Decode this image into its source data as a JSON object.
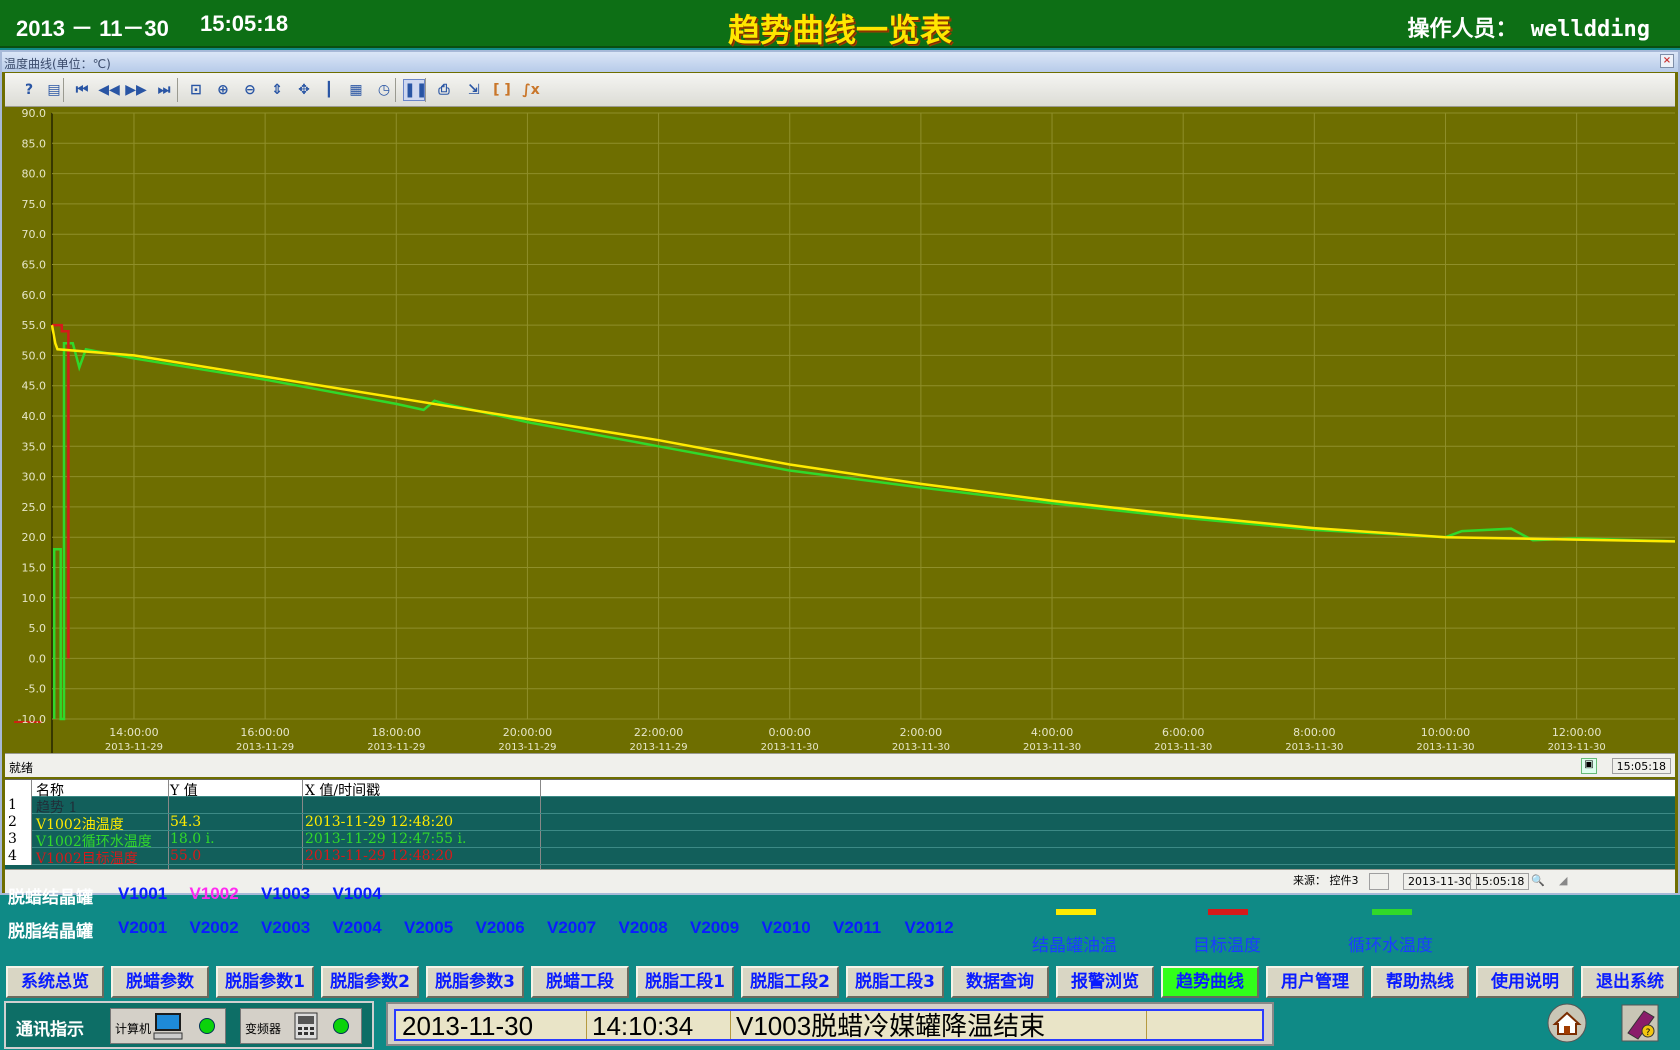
{
  "header": {
    "date": "2013 － 11－30",
    "time": "15:05:18",
    "title": "趋势曲线一览表",
    "operator": "操作人员： welldding"
  },
  "window": {
    "title": "温度曲线(单位：℃)",
    "close_label": "×",
    "status_text": "就绪",
    "status_time": "15:05:18",
    "toolbar_icons": [
      "help-icon",
      "properties-icon",
      "first-icon",
      "rewind-icon",
      "fast-forward-icon",
      "last-icon",
      "zoom-box-icon",
      "zoom-in-icon",
      "zoom-out-icon",
      "zoom-y-icon",
      "pan-icon",
      "ruler-icon",
      "grid-icon",
      "timer-icon",
      "pause-icon",
      "print-icon",
      "cursor-icon",
      "bracket-icon",
      "function-icon"
    ],
    "toolbar_glyphs": [
      "?",
      "▤",
      "⏮",
      "◀◀",
      "▶▶",
      "⏭",
      "⊡",
      "⊕",
      "⊖",
      "⇕",
      "✥",
      "┃",
      "▦",
      "◷",
      "❚❚",
      "⎙",
      "⇲",
      "[ ]",
      "∫x"
    ]
  },
  "legend_table": {
    "headers": [
      "名称",
      "Y 值",
      "X 值/时间戳"
    ],
    "rows": [
      {
        "num": "1",
        "name": "趋势 1",
        "y": "",
        "x": "",
        "color": "#20303a"
      },
      {
        "num": "2",
        "name": "V1002油温度",
        "y": "54.3",
        "x": "2013-11-29 12:48:20",
        "color": "#ffea00"
      },
      {
        "num": "3",
        "name": "V1002循环水温度",
        "y": "18.0 i.",
        "x": "2013-11-29 12:47:55 i.",
        "color": "#31d82a"
      },
      {
        "num": "4",
        "name": "V1002目标温度",
        "y": "55.0",
        "x": "2013-11-29 12:48:20",
        "color": "#d61a1a"
      }
    ]
  },
  "source_bar": {
    "source": "来源： 控件3",
    "date": "2013-11-30",
    "time": "15:05:18"
  },
  "chart_data": {
    "type": "line",
    "title": "温度曲线(单位：℃)",
    "xlabel": "",
    "ylabel": "",
    "ylim": [
      -10,
      90
    ],
    "y_ticks": [
      "90.0",
      "85.0",
      "80.0",
      "75.0",
      "70.0",
      "65.0",
      "60.0",
      "55.0",
      "50.0",
      "45.0",
      "40.0",
      "35.0",
      "30.0",
      "25.0",
      "20.0",
      "15.0",
      "10.0",
      "5.0",
      "0.0",
      "-5.0",
      "-10.0"
    ],
    "x_ticks": [
      {
        "t": "14:00:00",
        "d": "2013-11-29"
      },
      {
        "t": "16:00:00",
        "d": "2013-11-29"
      },
      {
        "t": "18:00:00",
        "d": "2013-11-29"
      },
      {
        "t": "20:00:00",
        "d": "2013-11-29"
      },
      {
        "t": "22:00:00",
        "d": "2013-11-29"
      },
      {
        "t": "0:00:00",
        "d": "2013-11-30"
      },
      {
        "t": "2:00:00",
        "d": "2013-11-30"
      },
      {
        "t": "4:00:00",
        "d": "2013-11-30"
      },
      {
        "t": "6:00:00",
        "d": "2013-11-30"
      },
      {
        "t": "8:00:00",
        "d": "2013-11-30"
      },
      {
        "t": "10:00:00",
        "d": "2013-11-30"
      },
      {
        "t": "12:00:00",
        "d": "2013-11-30"
      }
    ],
    "xlim": [
      "2013-11-29 12:45",
      "2013-11-30 13:30"
    ],
    "background": "#6e6e00",
    "grid": true,
    "series": [
      {
        "name": "结晶罐油温",
        "color": "#ffea00",
        "points": [
          [
            "2013-11-29 12:45",
            55
          ],
          [
            "2013-11-29 12:48",
            52
          ],
          [
            "2013-11-29 12:50",
            51
          ],
          [
            "2013-11-29 14:00",
            50
          ],
          [
            "2013-11-29 16:00",
            46.5
          ],
          [
            "2013-11-29 18:00",
            43
          ],
          [
            "2013-11-29 20:00",
            39.5
          ],
          [
            "2013-11-29 22:00",
            36
          ],
          [
            "2013-11-30 00:00",
            32
          ],
          [
            "2013-11-30 02:00",
            28.8
          ],
          [
            "2013-11-30 04:00",
            26
          ],
          [
            "2013-11-30 06:00",
            23.6
          ],
          [
            "2013-11-30 08:00",
            21.5
          ],
          [
            "2013-11-30 10:00",
            20
          ],
          [
            "2013-11-30 12:00",
            19.6
          ],
          [
            "2013-11-30 13:30",
            19.3
          ]
        ]
      },
      {
        "name": "目标温度",
        "color": "#d61a1a",
        "points": [
          [
            "2013-11-29 12:45",
            55
          ],
          [
            "2013-11-29 12:54",
            55
          ],
          [
            "2013-11-29 12:54",
            54
          ],
          [
            "2013-11-29 13:00",
            54
          ],
          [
            "2013-11-29 13:00",
            0
          ]
        ]
      },
      {
        "name": "循环水温度",
        "color": "#31d82a",
        "points": [
          [
            "2013-11-29 12:47",
            -10
          ],
          [
            "2013-11-29 12:47",
            18
          ],
          [
            "2013-11-29 12:53",
            18
          ],
          [
            "2013-11-29 12:53",
            -10
          ],
          [
            "2013-11-29 12:56",
            -10
          ],
          [
            "2013-11-29 12:56",
            52
          ],
          [
            "2013-11-29 13:04",
            52
          ],
          [
            "2013-11-29 13:10",
            48
          ],
          [
            "2013-11-29 13:16",
            51
          ],
          [
            "2013-11-29 14:00",
            49.5
          ],
          [
            "2013-11-29 16:00",
            46
          ],
          [
            "2013-11-29 18:00",
            42
          ],
          [
            "2013-11-29 18:25",
            41
          ],
          [
            "2013-11-29 18:35",
            42.5
          ],
          [
            "2013-11-29 18:45",
            42
          ],
          [
            "2013-11-29 20:00",
            39
          ],
          [
            "2013-11-29 22:00",
            35
          ],
          [
            "2013-11-30 00:00",
            31
          ],
          [
            "2013-11-30 02:00",
            28.2
          ],
          [
            "2013-11-30 04:00",
            25.6
          ],
          [
            "2013-11-30 06:00",
            23.2
          ],
          [
            "2013-11-30 08:00",
            21.2
          ],
          [
            "2013-11-30 10:00",
            20
          ],
          [
            "2013-11-30 10:15",
            21
          ],
          [
            "2013-11-30 11:00",
            21.4
          ],
          [
            "2013-11-30 11:20",
            19.5
          ],
          [
            "2013-11-30 12:00",
            19.8
          ],
          [
            "2013-11-30 13:30",
            19.3
          ]
        ]
      }
    ]
  },
  "tank_groups": [
    {
      "label": "脱蜡结晶罐",
      "tanks": [
        "V1001",
        "V1002",
        "V1003",
        "V1004"
      ],
      "selected": "V1002"
    },
    {
      "label": "脱脂结晶罐",
      "tanks": [
        "V2001",
        "V2002",
        "V2003",
        "V2004",
        "V2005",
        "V2006",
        "V2007",
        "V2008",
        "V2009",
        "V2010",
        "V2011",
        "V2012"
      ],
      "selected": ""
    }
  ],
  "legend": [
    {
      "label": "结晶罐油温",
      "color": "#ffea00"
    },
    {
      "label": "目标温度",
      "color": "#d61a1a"
    },
    {
      "label": "循环水温度",
      "color": "#31d82a"
    }
  ],
  "nav_buttons": [
    "系统总览",
    "脱蜡参数",
    "脱脂参数1",
    "脱脂参数2",
    "脱脂参数3",
    "脱蜡工段",
    "脱脂工段1",
    "脱脂工段2",
    "脱脂工段3",
    "数据查询",
    "报警浏览",
    "趋势曲线",
    "用户管理",
    "帮助热线",
    "使用说明",
    "退出系统"
  ],
  "active_nav": "趋势曲线",
  "comm": {
    "label": "通讯指示",
    "devices": [
      "计算机",
      "变频器"
    ],
    "status_color": "#0bd30b"
  },
  "alarm": {
    "date": "2013-11-30",
    "time": "14:10:34",
    "message": "V1003脱蜡冷媒罐降温结束"
  }
}
